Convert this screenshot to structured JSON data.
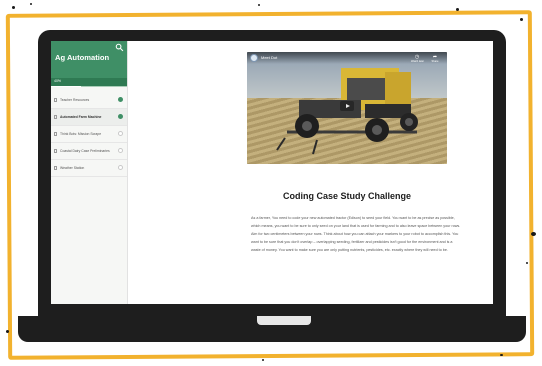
{
  "course": {
    "title": "Ag Automation",
    "progress_label": "40%",
    "progress_value": 0.4
  },
  "sidebar": {
    "items": [
      {
        "label": "Teacher Resources",
        "status": "complete",
        "active": false
      },
      {
        "label": "Automated Farm Machine",
        "status": "complete",
        "active": true
      },
      {
        "label": "Think Bots: Mission Scrape",
        "status": "incomplete",
        "active": false
      },
      {
        "label": "Coastal Dairy Case Preliminaries",
        "status": "incomplete",
        "active": false
      },
      {
        "label": "Weather Station",
        "status": "incomplete",
        "active": false
      }
    ]
  },
  "video": {
    "title": "Meet Dot",
    "watch_later_label": "Watch later",
    "share_label": "Share"
  },
  "lesson": {
    "heading": "Coding Case Study Challenge",
    "body": "As a farmer, You need to code your new automated tractor (Edison) to seed your field. You want to be as precise as possible, which means, you want to be sure to only seed on your land that is used for farming and to also leave space between your rows. Aim for two centimeters between your rows. Think about how you can attach your markers to your robot to accomplish this. You want to be sure that you don't overlap – overlapping seeding, fertilizer and pesticides isn't good for the environment and is a waste of money. You want to make sure you are only putting nutrients, pesticides, etc. exactly where they will need to be."
  },
  "colors": {
    "frame_accent": "#f2b22e",
    "sidebar_header": "#3f8f66",
    "laptop_body": "#1e1e1e"
  }
}
